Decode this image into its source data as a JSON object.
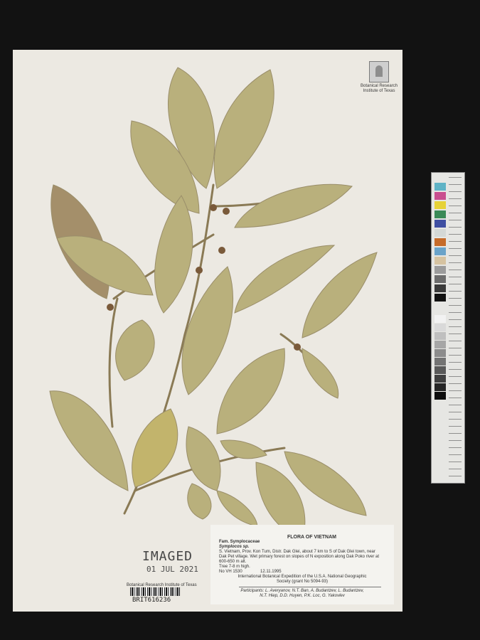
{
  "herbarium_logo": {
    "line1": "Botanical Research",
    "line2": "Institute of Texas"
  },
  "imaged_stamp": {
    "word": "IMAGED",
    "date": "01 JUL 2021"
  },
  "barcode": {
    "institution": "Botanical Research Institute of Texas",
    "id": "BRIT616236"
  },
  "label": {
    "flora": "FLORA OF VIETNAM",
    "family": "Fam. Symplocaceae",
    "species": "Symplocos sp.",
    "locality_1": "S. Vietnam, Prov. Kon Tum, Distr. Dak Glei, about 7 km to S of Dak Glei town, near",
    "locality_2": "Dak Pet village. Wet primary forest on slopes of N exposition along Dak Poko river at",
    "locality_3": "600-650 m alt.",
    "habit": "Tree 7-8 m high.",
    "collection_no": "No VH 1530",
    "date": "12.11.1995",
    "expedition_1": "International Botanical Expedition of the U.S.A. National Geographic",
    "expedition_2": "Society (grant No 5094-93)",
    "participants_1": "Participants: L. Averyanov, N.T. Ban, A. Budantzev, L. Budantzev,",
    "participants_2": "N.T. Hiep, D.D. Huyen, P.K. Loc, G. Yakovlev"
  },
  "color_chart": {
    "swatch_colors": [
      "#5fb3c6",
      "#c94f8f",
      "#e6d237",
      "#3a8a57",
      "#3f4fa2",
      "#d4d8d6",
      "#c66b2a",
      "#6aa3c9",
      "#d6c3a1",
      "#9b9b9b",
      "#6c6c6c",
      "#3a3a3a",
      "#111111"
    ]
  }
}
